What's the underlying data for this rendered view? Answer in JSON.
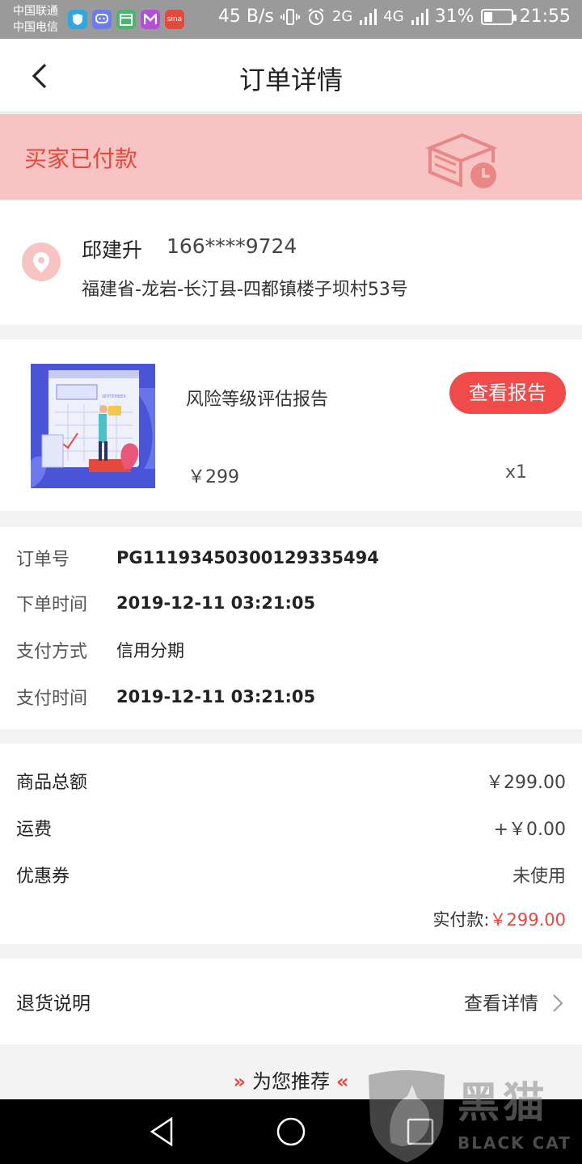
{
  "status_bar": {
    "carrier_1": "中国联通",
    "carrier_2": "中国电信",
    "net_speed": "45 B/s",
    "network_1": "2G",
    "network_2": "4G",
    "battery": "31%",
    "battery_level": 0.31,
    "time": "21:55",
    "app_icons": [
      "shield-app-icon",
      "chat-app-icon",
      "calendar-app-icon",
      "m-app-icon",
      "sina-app-icon"
    ],
    "sina_label": "sina"
  },
  "header": {
    "title": "订单详情"
  },
  "banner": {
    "status_text": "买家已付款"
  },
  "address": {
    "name": "邱建升",
    "phone": "166****9724",
    "detail": "福建省-龙岩-长汀县-四都镇楼子坝村53号"
  },
  "product": {
    "name": "风险等级评估报告",
    "button_label": "查看报告",
    "price": "￥299",
    "quantity": "x1",
    "thumb_caption": "SEPTEMBER"
  },
  "order_info": {
    "rows": [
      {
        "label": "订单号",
        "value": "PG11193450300129335494"
      },
      {
        "label": "下单时间",
        "value": "2019-12-11 03:21:05"
      },
      {
        "label": "支付方式",
        "value": "信用分期"
      },
      {
        "label": "支付时间",
        "value": "2019-12-11 03:21:05"
      }
    ]
  },
  "amounts": {
    "rows": [
      {
        "label": "商品总额",
        "value": "￥299.00"
      },
      {
        "label": "运费",
        "value": "+￥0.00"
      },
      {
        "label": "优惠券",
        "value": "未使用"
      }
    ],
    "paid_label": "实付款:",
    "paid_value": "￥299.00"
  },
  "returns": {
    "label": "退货说明",
    "link": "查看详情"
  },
  "recommend": {
    "title": "为您推荐",
    "arrow_left": "»",
    "arrow_right": "«"
  },
  "watermark": {
    "text": "黑猫",
    "sub": "BLACK CAT"
  },
  "colors": {
    "accent": "#e5493e",
    "button": "#f04a4a",
    "banner_bg": "#f8c3c3"
  }
}
